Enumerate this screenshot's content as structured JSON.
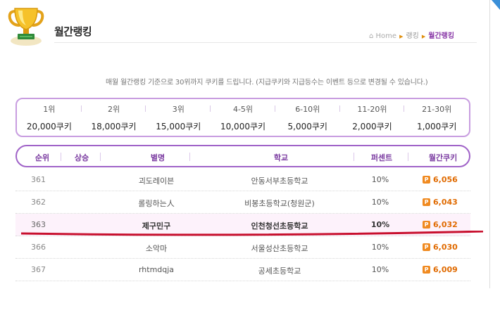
{
  "page": {
    "title": "월간랭킹",
    "breadcrumb": [
      "Home",
      "랭킹",
      "월간랭킹"
    ]
  },
  "notice": "매월 월간랭킹 기준으로 30위까지 쿠키를 드립니다. (지급쿠키와 지급등수는 이벤트 등으로 변경될 수 있습니다.)",
  "rewards": [
    {
      "rank": "1위",
      "amount": "20,000쿠키"
    },
    {
      "rank": "2위",
      "amount": "18,000쿠키"
    },
    {
      "rank": "3위",
      "amount": "15,000쿠키"
    },
    {
      "rank": "4-5위",
      "amount": "10,000쿠키"
    },
    {
      "rank": "6-10위",
      "amount": "5,000쿠키"
    },
    {
      "rank": "11-20위",
      "amount": "2,000쿠키"
    },
    {
      "rank": "21-30위",
      "amount": "1,000쿠키"
    }
  ],
  "table": {
    "headers": {
      "rank": "순위",
      "rise": "상승",
      "nick": "별명",
      "school": "학교",
      "percent": "퍼센트",
      "cookie": "월간쿠키"
    },
    "rows": [
      {
        "rank": "361",
        "nick": "괴도레이븐",
        "school": "안동서부초등학교",
        "percent": "10%",
        "cookie": "6,056"
      },
      {
        "rank": "362",
        "nick": "롤링하는人",
        "school": "비봉초등학교(청원군)",
        "percent": "10%",
        "cookie": "6,043"
      },
      {
        "rank": "363",
        "nick": "제구민구",
        "school": "인천청선초등학교",
        "percent": "10%",
        "cookie": "6,032"
      },
      {
        "rank": "366",
        "nick": "소악마",
        "school": "서울성산초등학교",
        "percent": "10%",
        "cookie": "6,030"
      },
      {
        "rank": "367",
        "nick": "rhtmdqja",
        "school": "공세초등학교",
        "percent": "10%",
        "cookie": "6,009"
      }
    ]
  },
  "icons": {
    "cookie": "P"
  },
  "colors": {
    "accent": "#a063c8",
    "cookie": "#e06a00",
    "highlight_line": "#c8102e"
  }
}
